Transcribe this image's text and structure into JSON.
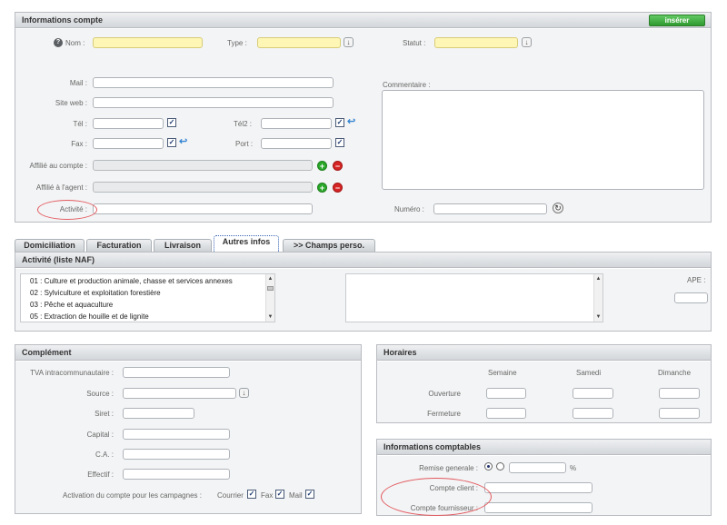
{
  "compte": {
    "title": "Informations compte",
    "insert_label": "insérer",
    "nom_label": "Nom :",
    "type_label": "Type :",
    "statut_label": "Statut :",
    "mail_label": "Mail :",
    "site_label": "Site web :",
    "tel_label": "Tél :",
    "tel2_label": "Tél2 :",
    "fax_label": "Fax :",
    "port_label": "Port :",
    "affilie_compte_label": "Affilié au compte :",
    "affilie_agent_label": "Affilié à l'agent :",
    "activite_label": "Activité :",
    "commentaire_label": "Commentaire :",
    "numero_label": "Numéro :",
    "check_mark": "✓"
  },
  "tabs": [
    "Domiciliation",
    "Facturation",
    "Livraison",
    "Autres infos",
    ">> Champs perso."
  ],
  "activite_panel": {
    "title": "Activité (liste NAF)",
    "items": [
      "01 : Culture et production animale, chasse et services annexes",
      "02 : Sylviculture et exploitation forestière",
      "03 : Pêche et aquaculture",
      "05 : Extraction de houille et de lignite"
    ],
    "ape_label": "APE :"
  },
  "complement": {
    "title": "Complément",
    "tva_label": "TVA intracommunautaire :",
    "source_label": "Source :",
    "siret_label": "Siret :",
    "capital_label": "Capital :",
    "ca_label": "C.A. :",
    "effectif_label": "Effectif :",
    "activation_label": "Activation du compte pour les campagnes :",
    "courrier_label": "Courrier",
    "fax_label": "Fax",
    "mail_label": "Mail"
  },
  "horaires": {
    "title": "Horaires",
    "col_semaine": "Semaine",
    "col_samedi": "Samedi",
    "col_dimanche": "Dimanche",
    "row_ouverture": "Ouverture",
    "row_fermeture": "Fermeture"
  },
  "comptables": {
    "title": "Informations comptables",
    "remise_label": "Remise generale :",
    "percent": "%",
    "compte_client_label": "Compte client :",
    "compte_fournisseur_label": "Compte fournisseur :"
  }
}
